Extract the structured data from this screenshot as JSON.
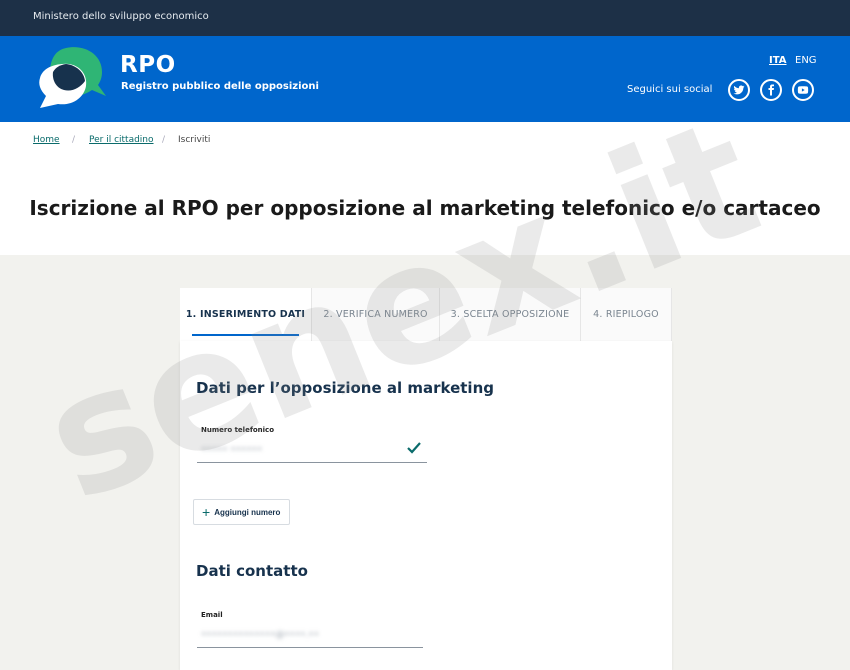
{
  "topbar": {
    "ministry": "Ministero dello sviluppo economico"
  },
  "header": {
    "title": "RPO",
    "subtitle": "Registro pubblico delle opposizioni",
    "lang_active": "ITA",
    "lang_other": "ENG",
    "social_label": "Seguici sui social",
    "social_icons": [
      "twitter-icon",
      "facebook-icon",
      "youtube-icon"
    ]
  },
  "breadcrumb": {
    "home": "Home",
    "citizen": "Per il cittadino",
    "current": "Iscriviti"
  },
  "page": {
    "title": "Iscrizione al RPO per opposizione al marketing telefonico e/o cartaceo"
  },
  "tabs": [
    "1. INSERIMENTO DATI",
    "2. VERIFICA NUMERO",
    "3. SCELTA OPPOSIZIONE",
    "4. RIEPILOGO"
  ],
  "form": {
    "section_marketing": "Dati per l’opposizione al marketing",
    "phone_label": "Numero telefonico",
    "phone_value": "••••• ••••••",
    "add_number": "Aggiungi numero",
    "section_contact": "Dati contatto",
    "email_label": "Email",
    "email_value": "••••••••••••••@••••.••"
  },
  "watermark": "senex.it",
  "colors": {
    "brand_blue": "#0066cc",
    "topbar": "#1d3047",
    "accent_teal": "#0a6b6b"
  }
}
